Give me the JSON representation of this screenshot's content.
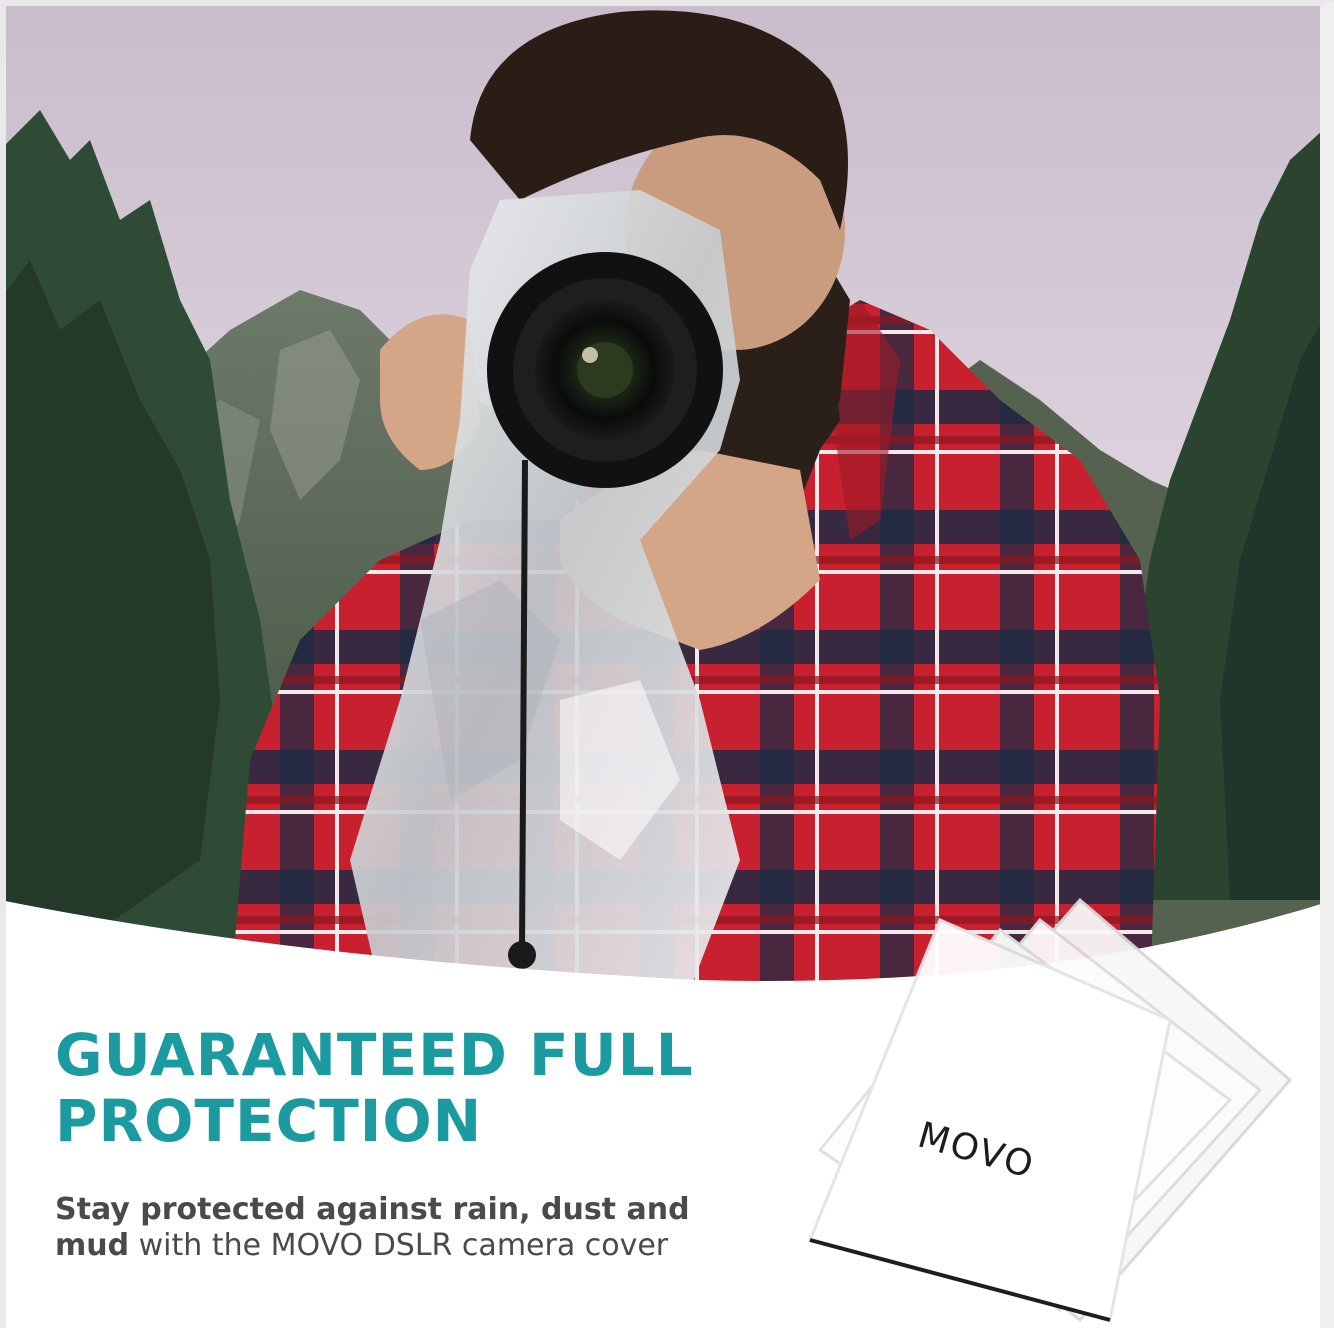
{
  "headline": {
    "line1": "GUARANTEED FULL",
    "line2": "PROTECTION"
  },
  "subtitle": {
    "bold_part_line1": "Stay protected against rain, dust and",
    "bold_part_line2": "mud",
    "normal_part": " with the MOVO DSLR camera cover"
  },
  "product_pack": {
    "brand": "MOVO"
  },
  "colors": {
    "accent": "#1b9aa0",
    "body_text": "#4a4a4a",
    "shirt_red": "#c8202e",
    "shirt_navy": "#1f2a44",
    "forest": "#2f4a35",
    "sky": "#d9cfdc"
  }
}
